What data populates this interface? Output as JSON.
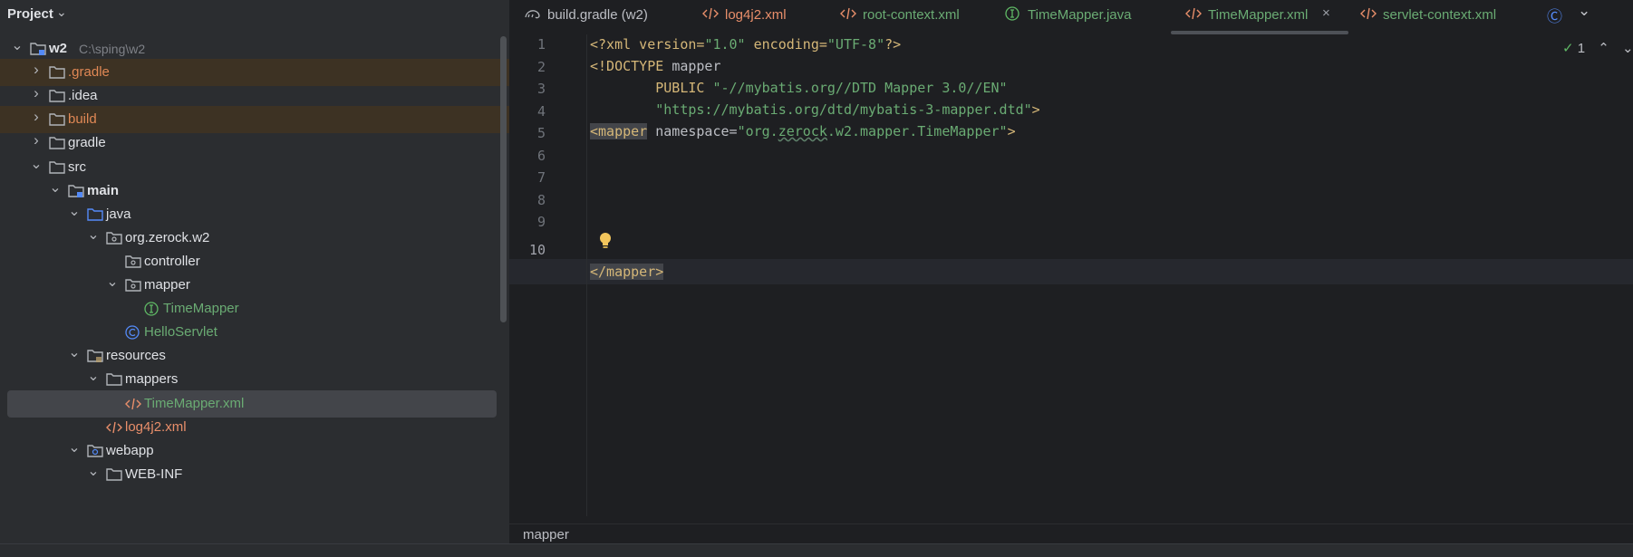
{
  "project": {
    "title": "Project",
    "tree": [
      {
        "label": "w2",
        "path": "C:\\sping\\w2",
        "depth": 0,
        "arrow": "down",
        "icon": "module-folder-icon",
        "color": "#dfe1e5",
        "bold": true,
        "highlight": false
      },
      {
        "label": ".gradle",
        "depth": 1,
        "arrow": "right",
        "icon": "folder-icon",
        "color": "#e08855",
        "bold": false,
        "highlight": true
      },
      {
        "label": ".idea",
        "depth": 1,
        "arrow": "right",
        "icon": "folder-icon",
        "color": "#dfe1e5",
        "bold": false,
        "highlight": false
      },
      {
        "label": "build",
        "depth": 1,
        "arrow": "right",
        "icon": "folder-icon",
        "color": "#e08855",
        "bold": false,
        "highlight": true
      },
      {
        "label": "gradle",
        "depth": 1,
        "arrow": "right",
        "icon": "folder-icon",
        "color": "#dfe1e5",
        "bold": false,
        "highlight": false
      },
      {
        "label": "src",
        "depth": 1,
        "arrow": "down",
        "icon": "folder-icon",
        "color": "#dfe1e5",
        "bold": false,
        "highlight": false
      },
      {
        "label": "main",
        "depth": 2,
        "arrow": "down",
        "icon": "module-folder-icon",
        "color": "#dfe1e5",
        "bold": true,
        "highlight": false
      },
      {
        "label": "java",
        "depth": 3,
        "arrow": "down",
        "icon": "source-folder-icon",
        "color": "#dfe1e5",
        "bold": false,
        "highlight": false
      },
      {
        "label": "org.zerock.w2",
        "depth": 4,
        "arrow": "down",
        "icon": "package-icon",
        "color": "#dfe1e5",
        "bold": false,
        "highlight": false
      },
      {
        "label": "controller",
        "depth": 5,
        "arrow": "none",
        "icon": "package-icon",
        "color": "#dfe1e5",
        "bold": false,
        "highlight": false
      },
      {
        "label": "mapper",
        "depth": 5,
        "arrow": "down",
        "icon": "package-icon",
        "color": "#dfe1e5",
        "bold": false,
        "highlight": false
      },
      {
        "label": "TimeMapper",
        "depth": 6,
        "arrow": "none",
        "icon": "interface-icon",
        "color": "#6aab73",
        "bold": false,
        "highlight": false
      },
      {
        "label": "HelloServlet",
        "depth": 5,
        "arrow": "none",
        "icon": "class-icon",
        "color": "#6aab73",
        "bold": false,
        "highlight": false
      },
      {
        "label": "resources",
        "depth": 3,
        "arrow": "down",
        "icon": "resources-folder-icon",
        "color": "#dfe1e5",
        "bold": false,
        "highlight": false
      },
      {
        "label": "mappers",
        "depth": 4,
        "arrow": "down",
        "icon": "folder-icon",
        "color": "#dfe1e5",
        "bold": false,
        "highlight": false
      },
      {
        "label": "TimeMapper.xml",
        "depth": 5,
        "arrow": "none",
        "icon": "xml-file-icon",
        "color": "#6aab73",
        "bold": false,
        "highlight": false,
        "selected": true
      },
      {
        "label": "log4j2.xml",
        "depth": 4,
        "arrow": "none",
        "icon": "xml-file-icon",
        "color": "#e88e6a",
        "bold": false,
        "highlight": false
      },
      {
        "label": "webapp",
        "depth": 3,
        "arrow": "down",
        "icon": "web-folder-icon",
        "color": "#dfe1e5",
        "bold": false,
        "highlight": false
      },
      {
        "label": "WEB-INF",
        "depth": 4,
        "arrow": "down",
        "icon": "folder-icon",
        "color": "#dfe1e5",
        "bold": false,
        "highlight": false
      }
    ]
  },
  "tabs": [
    {
      "label": "build.gradle (w2)",
      "icon": "gradle-icon",
      "color": "#bcbec4",
      "active": false
    },
    {
      "label": "log4j2.xml",
      "icon": "xml-file-icon",
      "color": "#e88e6a",
      "active": false
    },
    {
      "label": "root-context.xml",
      "icon": "xml-file-icon",
      "color": "#6aab73",
      "active": false
    },
    {
      "label": "TimeMapper.java",
      "icon": "interface-icon",
      "color": "#6aab73",
      "active": false
    },
    {
      "label": "TimeMapper.xml",
      "icon": "xml-file-icon",
      "color": "#6aab73",
      "active": true
    },
    {
      "label": "servlet-context.xml",
      "icon": "xml-file-icon",
      "color": "#6aab73",
      "active": false
    }
  ],
  "editor": {
    "line_numbers": [
      "1",
      "2",
      "3",
      "4",
      "5",
      "6",
      "7",
      "8",
      "9",
      "10"
    ],
    "current_line": "10",
    "inspection_count": "1",
    "code": {
      "l1_a": "<?xml version=",
      "l1_b": "\"1.0\"",
      "l1_c": " encoding=",
      "l1_d": "\"UTF-8\"",
      "l1_e": "?>",
      "l2_a": "<!DOCTYPE ",
      "l2_b": "mapper",
      "l3_a": "        PUBLIC ",
      "l3_b": "\"-//mybatis.org//DTD Mapper 3.0//EN\"",
      "l4_a": "        ",
      "l4_b": "\"https://mybatis.org/dtd/mybatis-3-mapper.dtd\"",
      "l4_c": ">",
      "l5_a": "<mapper",
      "l5_b": " namespace=",
      "l5_c": "\"org.",
      "l5_d": "zerock",
      "l5_e": ".w2.mapper.TimeMapper\"",
      "l5_f": ">",
      "l10_a": "</mapper>"
    }
  },
  "breadcrumb": "mapper",
  "colors": {
    "accent": "#548af7",
    "string": "#6aab73",
    "tag": "#d5b778",
    "ignored": "#e08855"
  }
}
